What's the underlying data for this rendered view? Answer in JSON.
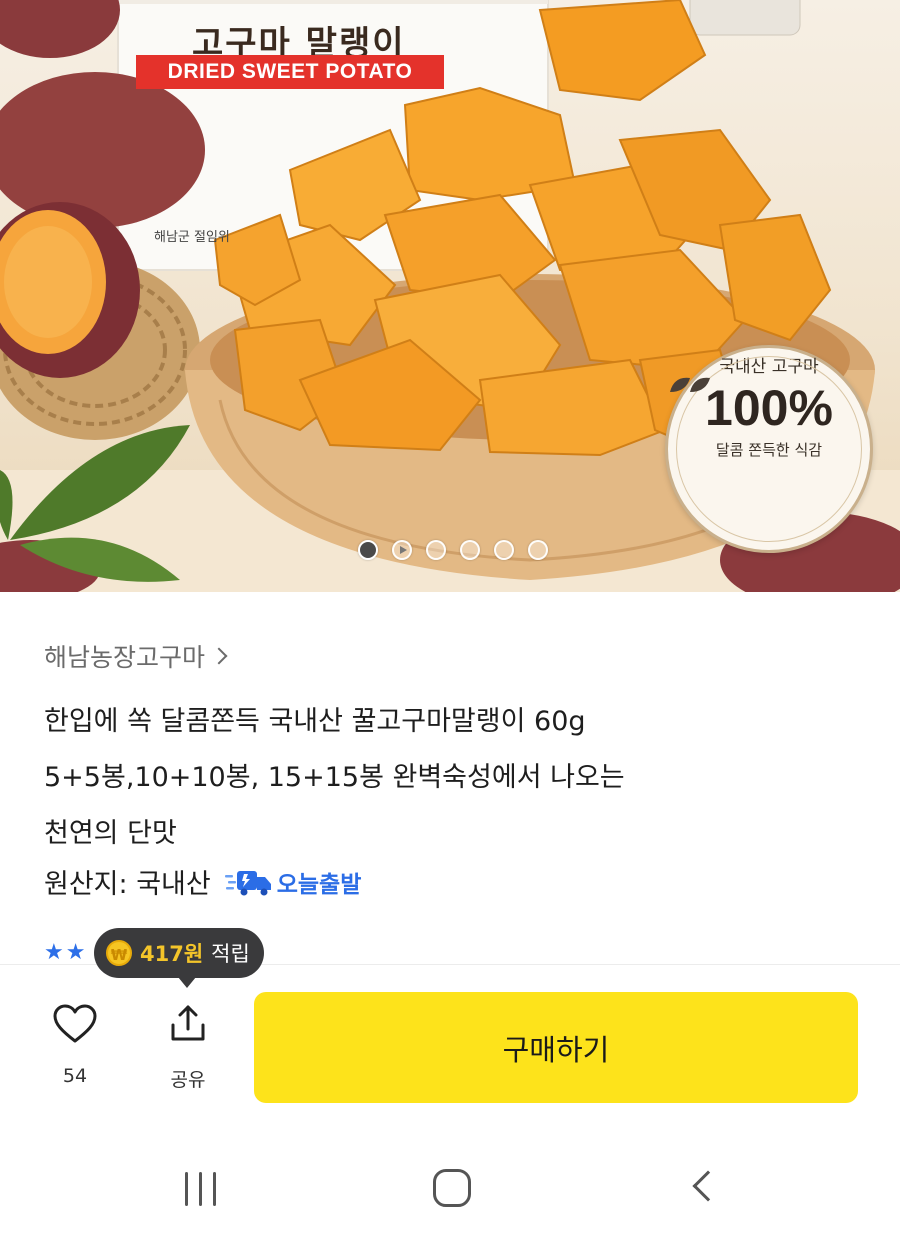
{
  "hero": {
    "bag_title": "고구마 말랭이",
    "bag_banner": "DRIED SWEET POTATO",
    "bag_maker": "해남군 절임위",
    "badge": {
      "top_text": "국내산 고구마",
      "big_text": "100%",
      "bottom_text": "달콤 쫀득한 식감",
      "icon": "leaf-icon"
    },
    "carousel": {
      "total_dots": 6,
      "active_index": 1
    }
  },
  "product": {
    "seller": "해남농장고구마",
    "title_lines": [
      "한입에 쏙 달콤쫀득 국내산 꿀고구마말랭이 60g",
      "5+5봉,10+10봉, 15+15봉 완벽숙성에서 나오는",
      "천연의 단맛"
    ],
    "origin": "원산지: 국내산",
    "shipping_label": "오늘출발",
    "shipping_icon": "delivery-truck-icon"
  },
  "reward": {
    "coin_symbol": "₩",
    "amount": "417원",
    "suffix": "적립"
  },
  "actions": {
    "like_count": "54",
    "share_label": "공유",
    "buy_label": "구매하기"
  },
  "colors": {
    "buy_button": "#fde31b",
    "shipping_blue": "#2b6de6",
    "tooltip_bg": "#3a3a3c",
    "points_gold": "#f4c52a"
  },
  "navbar": {
    "icons": [
      "recents-icon",
      "home-icon",
      "back-icon"
    ]
  }
}
